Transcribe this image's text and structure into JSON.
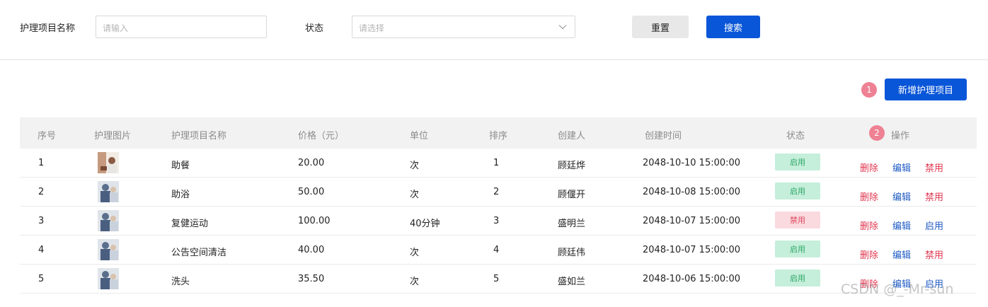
{
  "filters": {
    "name_label": "护理项目名称",
    "name_placeholder": "请输入",
    "status_label": "状态",
    "status_placeholder": "请选择",
    "reset_label": "重置",
    "search_label": "搜索"
  },
  "toolbar": {
    "badge1": "1",
    "badge2": "2",
    "add_label": "新增护理项目"
  },
  "table": {
    "headers": [
      "序号",
      "护理图片",
      "护理项目名称",
      "价格（元）",
      "单位",
      "排序",
      "创建人",
      "创建时间",
      "状态",
      "操作"
    ],
    "rows": [
      {
        "no": "1",
        "name": "助餐",
        "price": "20.00",
        "unit": "次",
        "sort": "1",
        "creator": "顾廷烨",
        "time": "2048-10-10 15:00:00",
        "status": "启用",
        "status_type": "on",
        "actions": [
          "删除",
          "编辑",
          "禁用"
        ]
      },
      {
        "no": "2",
        "name": "助浴",
        "price": "50.00",
        "unit": "次",
        "sort": "2",
        "creator": "顾偃开",
        "time": "2048-10-08 15:00:00",
        "status": "启用",
        "status_type": "on",
        "actions": [
          "删除",
          "编辑",
          "禁用"
        ]
      },
      {
        "no": "3",
        "name": "复健运动",
        "price": "100.00",
        "unit": "40分钟",
        "sort": "3",
        "creator": "盛明兰",
        "time": "2048-10-07 15:00:00",
        "status": "禁用",
        "status_type": "off",
        "actions": [
          "删除",
          "编辑",
          "启用"
        ]
      },
      {
        "no": "4",
        "name": "公告空间清洁",
        "price": "40.00",
        "unit": "次",
        "sort": "4",
        "creator": "顾廷伟",
        "time": "2048-10-07 15:00:00",
        "status": "启用",
        "status_type": "on",
        "actions": [
          "删除",
          "编辑",
          "禁用"
        ]
      },
      {
        "no": "5",
        "name": "洗头",
        "price": "35.50",
        "unit": "次",
        "sort": "5",
        "creator": "盛如兰",
        "time": "2048-10-06 15:00:00",
        "status": "启用",
        "status_type": "on",
        "actions": [
          "删除",
          "编辑",
          "启用"
        ]
      }
    ]
  },
  "colors": {
    "primary": "#0a56d8",
    "danger": "#e0364f",
    "enabled_bg": "#c5eedb",
    "disabled_bg": "#fadadf",
    "badge": "#ee8193"
  },
  "icons": {
    "select_arrow": "chevron-down-icon",
    "thumbnail": "care-photo"
  },
  "watermark": "CSDN @_-Mr-sun"
}
